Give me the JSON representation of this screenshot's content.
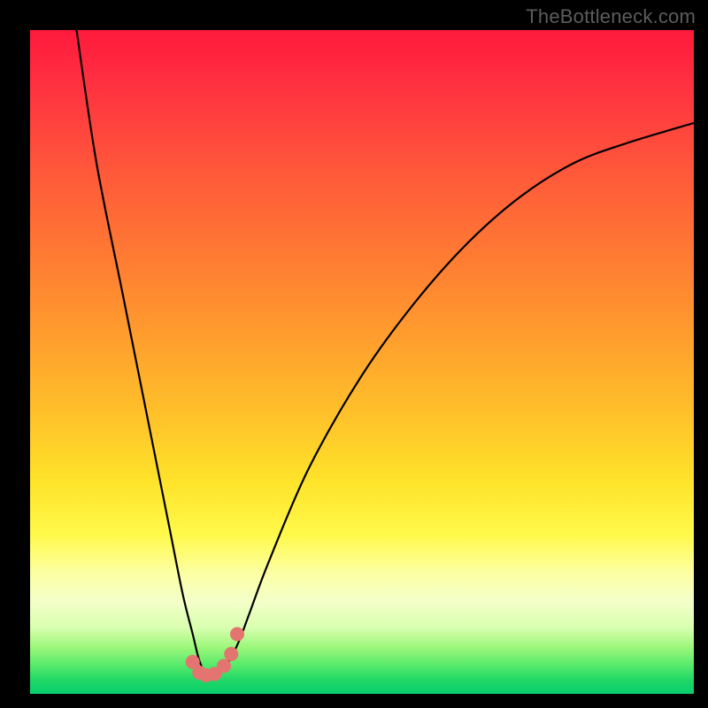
{
  "watermark": "TheBottleneck.com",
  "chart_data": {
    "type": "line",
    "title": "",
    "xlabel": "",
    "ylabel": "",
    "xlim": [
      0,
      100
    ],
    "ylim": [
      0,
      100
    ],
    "grid": false,
    "series": [
      {
        "name": "bottleneck-curve",
        "color": "#000000",
        "x": [
          7,
          10,
          14,
          18,
          21,
          23,
          24.5,
          25.5,
          26.5,
          27.5,
          28.5,
          30,
          31.5,
          33,
          36,
          42,
          50,
          58,
          66,
          74,
          82,
          90,
          100
        ],
        "y": [
          100,
          80,
          60,
          40,
          25,
          15,
          9,
          5,
          3,
          2.8,
          3,
          5,
          8,
          12,
          20,
          34,
          48,
          59,
          68,
          75,
          80,
          83,
          86
        ]
      }
    ],
    "markers": [
      {
        "name": "pink-dot",
        "color": "#e4746f",
        "x": 24.5,
        "y": 4.8
      },
      {
        "name": "pink-dot",
        "color": "#e4746f",
        "x": 25.5,
        "y": 3.2
      },
      {
        "name": "pink-dot",
        "color": "#e4746f",
        "x": 26.5,
        "y": 2.8
      },
      {
        "name": "pink-dot",
        "color": "#e4746f",
        "x": 27.8,
        "y": 3.0
      },
      {
        "name": "pink-dot",
        "color": "#e4746f",
        "x": 29.2,
        "y": 4.2
      },
      {
        "name": "pink-dot",
        "color": "#e4746f",
        "x": 30.3,
        "y": 6.0
      },
      {
        "name": "pink-dot",
        "color": "#e4746f",
        "x": 31.2,
        "y": 9.0
      }
    ]
  }
}
